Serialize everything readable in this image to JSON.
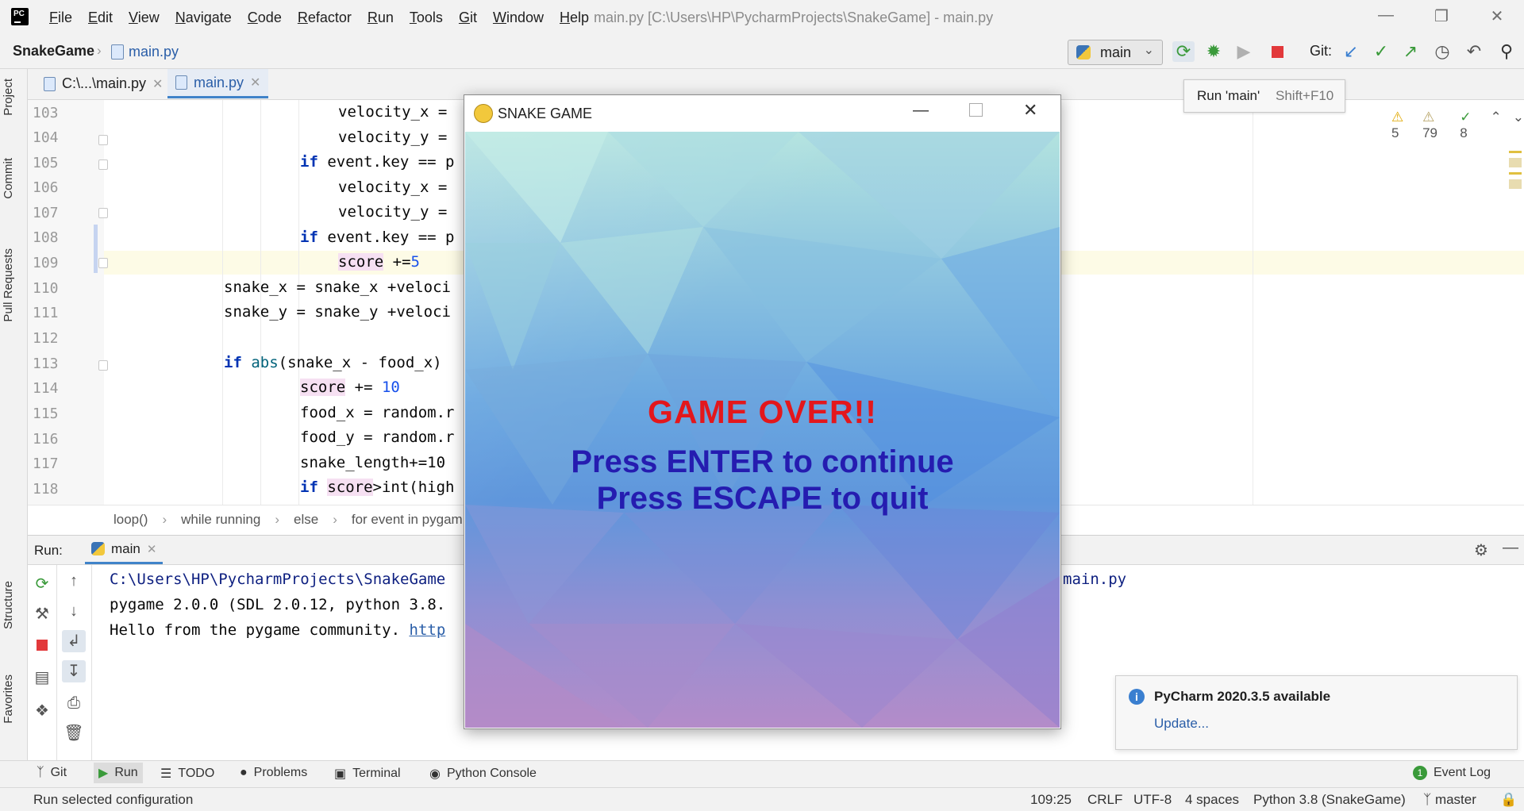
{
  "app": {
    "menu": [
      "File",
      "Edit",
      "View",
      "Navigate",
      "Code",
      "Refactor",
      "Run",
      "Tools",
      "Git",
      "Window",
      "Help"
    ],
    "window_title": "main.py [C:\\Users\\HP\\PycharmProjects\\SnakeGame] - main.py"
  },
  "nav": {
    "project": "SnakeGame",
    "file": "main.py",
    "run_config": "main",
    "git_label": "Git:"
  },
  "tooltip": {
    "text": "Run 'main'",
    "shortcut": "Shift+F10"
  },
  "left_strip": [
    "Project",
    "Commit",
    "Pull Requests",
    "Structure",
    "Favorites"
  ],
  "tabs": [
    {
      "label": "C:\\...\\main.py"
    },
    {
      "label": "main.py"
    }
  ],
  "inspections": {
    "warnings": "5",
    "weak_warnings": "79",
    "typos": "8"
  },
  "code_lines": [
    {
      "n": "103",
      "text": "velocity_x = "
    },
    {
      "n": "104",
      "text": "velocity_y = "
    },
    {
      "n": "105",
      "kw": "if",
      "text": " event.key == p"
    },
    {
      "n": "106",
      "text": "velocity_x = "
    },
    {
      "n": "107",
      "text": "velocity_y = "
    },
    {
      "n": "108",
      "kw": "if",
      "text": " event.key == p"
    },
    {
      "n": "109",
      "var": "score",
      "text": " +=",
      "num": "5"
    },
    {
      "n": "110",
      "text": "snake_x = snake_x +veloci"
    },
    {
      "n": "111",
      "text": "snake_y = snake_y +veloci"
    },
    {
      "n": "112",
      "text": ""
    },
    {
      "n": "113",
      "kw": "if",
      "fn": "abs",
      "text": "(snake_x - food_x) "
    },
    {
      "n": "114",
      "var": "score",
      "text": " += ",
      "num": "10"
    },
    {
      "n": "115",
      "text": "food_x = random.r"
    },
    {
      "n": "116",
      "text": "food_y = random.r"
    },
    {
      "n": "117",
      "text": "snake_length+=10"
    },
    {
      "n": "118",
      "kw": "if",
      "var": "score",
      "text": ">int(high"
    }
  ],
  "breadcrumbs": [
    "loop()",
    "while running",
    "else",
    "for event in pygam"
  ],
  "run": {
    "label": "Run:",
    "tab": "main",
    "output": [
      "C:\\Users\\HP\\PycharmProjects\\SnakeGame",
      "pygame 2.0.0 (SDL 2.0.12, python 3.8.",
      "Hello from the pygame community. "
    ],
    "output_link": "http",
    "output_tail": "main.py"
  },
  "bottom_tools": [
    "Git",
    "Run",
    "TODO",
    "Problems",
    "Terminal",
    "Python Console"
  ],
  "event_log": "Event Log",
  "status": {
    "message": "Run selected configuration",
    "position": "109:25",
    "line_sep": "CRLF",
    "encoding": "UTF-8",
    "indent": "4 spaces",
    "interpreter": "Python 3.8 (SnakeGame)",
    "branch": "master"
  },
  "notification": {
    "title": "PyCharm 2020.3.5 available",
    "action": "Update..."
  },
  "game": {
    "title": "SNAKE GAME",
    "game_over": "GAME OVER!!",
    "line1": "Press ENTER to continue",
    "line2": "Press ESCAPE to quit",
    "colors": {
      "game_over": "#e3171c",
      "prompt": "#251cb0"
    }
  }
}
